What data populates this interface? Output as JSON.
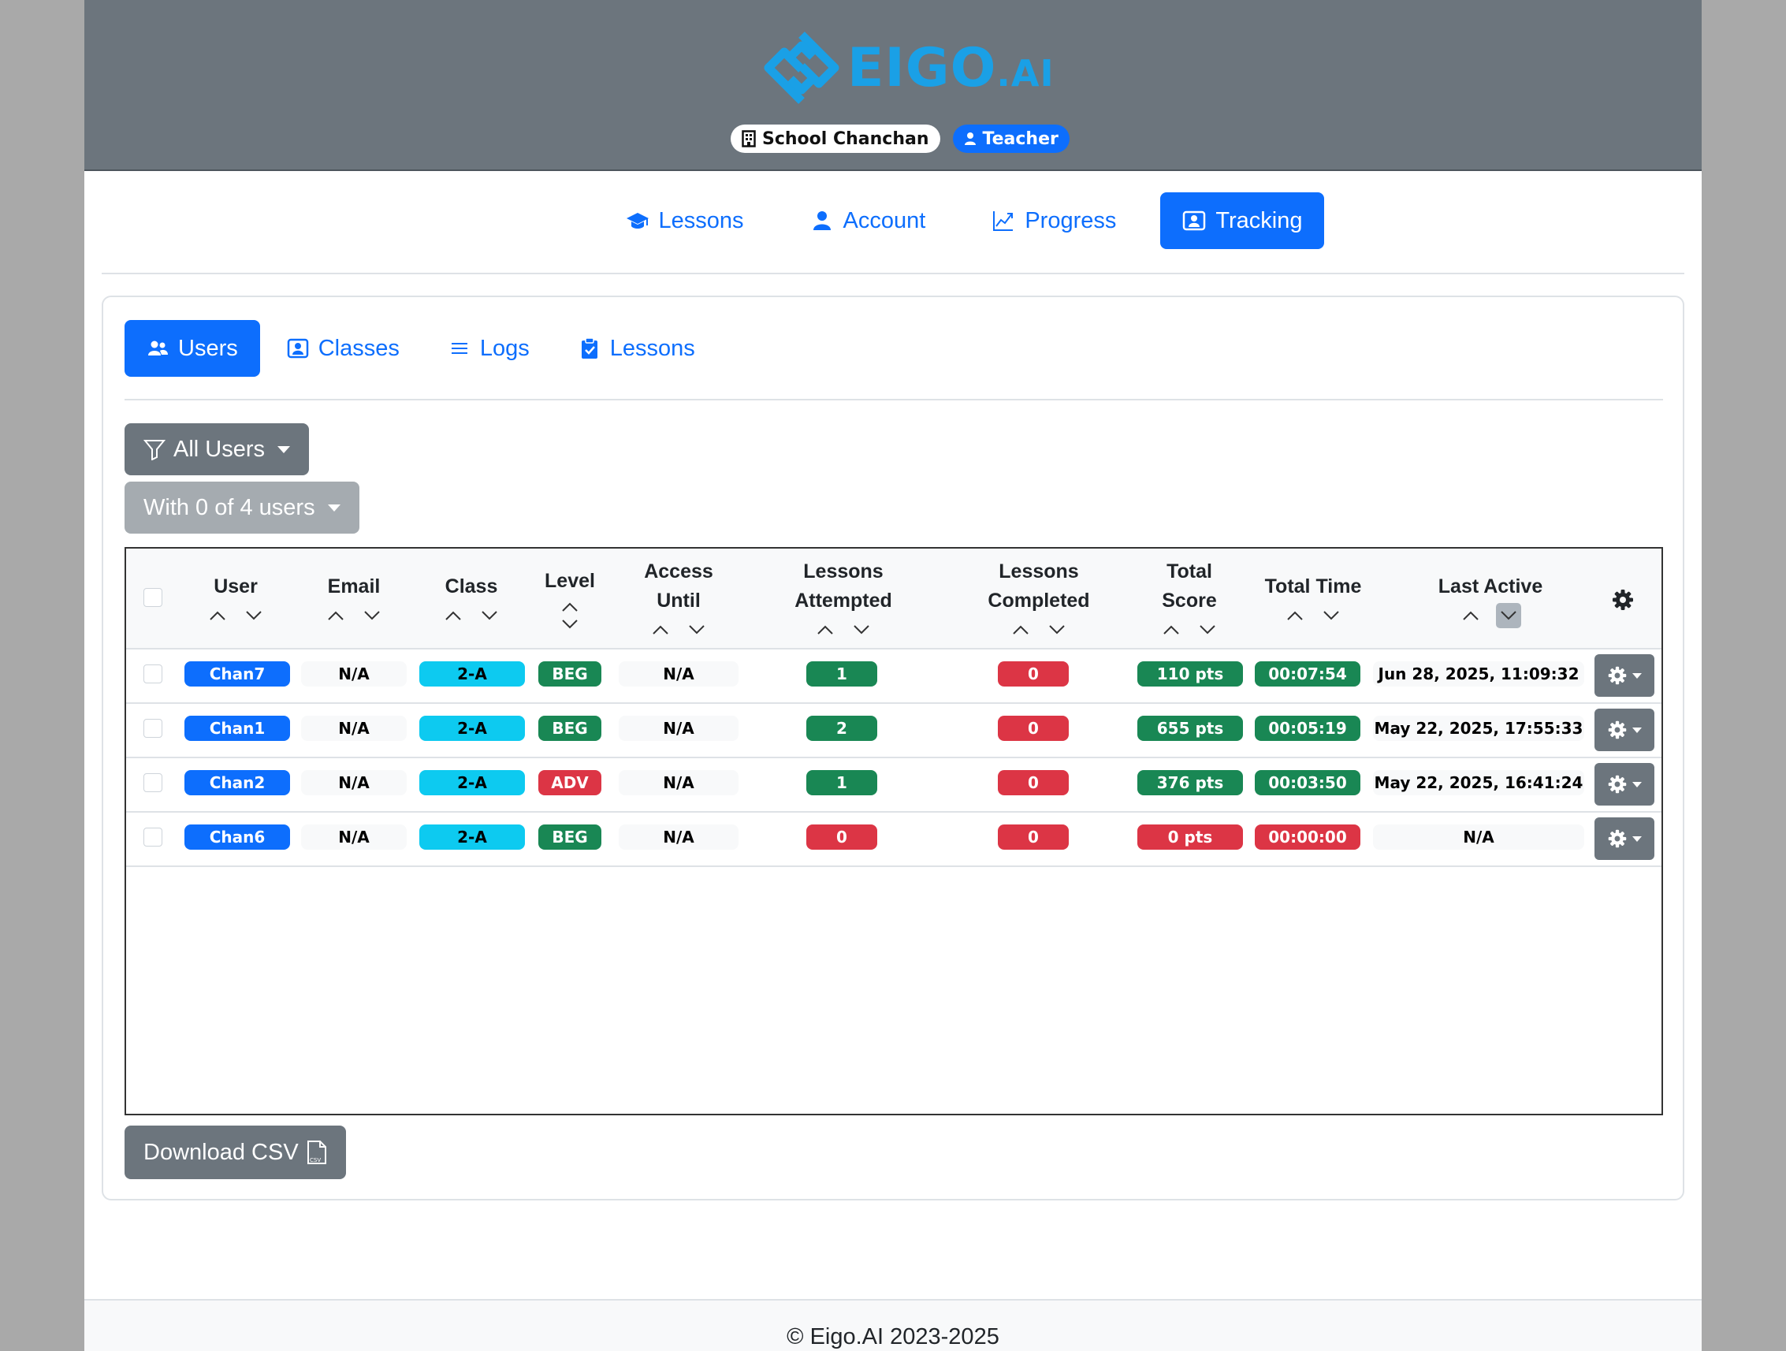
{
  "brand": {
    "logo_text": "EIGO",
    "logo_suffix": ".AI",
    "color": "#1aa0e6"
  },
  "header": {
    "school": "School Chanchan",
    "role": "Teacher"
  },
  "main_nav": [
    {
      "label": "Lessons",
      "icon": "graduation-cap-icon"
    },
    {
      "label": "Account",
      "icon": "person-icon"
    },
    {
      "label": "Progress",
      "icon": "graph-up-icon"
    },
    {
      "label": "Tracking",
      "icon": "person-badge-icon",
      "active": true
    }
  ],
  "sub_nav": [
    {
      "label": "Users",
      "icon": "people-icon",
      "active": true
    },
    {
      "label": "Classes",
      "icon": "person-square-icon"
    },
    {
      "label": "Logs",
      "icon": "list-icon"
    },
    {
      "label": "Lessons",
      "icon": "clipboard-check-icon"
    }
  ],
  "filter": {
    "label": "All Users"
  },
  "selection": {
    "label": "With 0 of 4 users"
  },
  "table": {
    "headers": {
      "user": "User",
      "email": "Email",
      "class": "Class",
      "level": "Level",
      "access_until_1": "Access",
      "access_until_2": "Until",
      "lessons_attempted_1": "Lessons",
      "lessons_attempted_2": "Attempted",
      "lessons_completed_1": "Lessons",
      "lessons_completed_2": "Completed",
      "total_score_1": "Total",
      "total_score_2": "Score",
      "total_time": "Total Time",
      "last_active": "Last Active"
    },
    "rows": [
      {
        "user": "Chan7",
        "email": "N/A",
        "class": "2-A",
        "level": "BEG",
        "access_until": "N/A",
        "attempted": "1",
        "completed": "0",
        "score": "110 pts",
        "time": "00:07:54",
        "last_active": "Jun 28, 2025, 11:09:32"
      },
      {
        "user": "Chan1",
        "email": "N/A",
        "class": "2-A",
        "level": "BEG",
        "access_until": "N/A",
        "attempted": "2",
        "completed": "0",
        "score": "655 pts",
        "time": "00:05:19",
        "last_active": "May 22, 2025, 17:55:33"
      },
      {
        "user": "Chan2",
        "email": "N/A",
        "class": "2-A",
        "level": "ADV",
        "access_until": "N/A",
        "attempted": "1",
        "completed": "0",
        "score": "376 pts",
        "time": "00:03:50",
        "last_active": "May 22, 2025, 16:41:24"
      },
      {
        "user": "Chan6",
        "email": "N/A",
        "class": "2-A",
        "level": "BEG",
        "access_until": "N/A",
        "attempted": "0",
        "completed": "0",
        "score": "0 pts",
        "time": "00:00:00",
        "last_active": "N/A"
      }
    ]
  },
  "download": {
    "label": "Download CSV"
  },
  "footer": {
    "text": "© Eigo.AI 2023-2025"
  }
}
